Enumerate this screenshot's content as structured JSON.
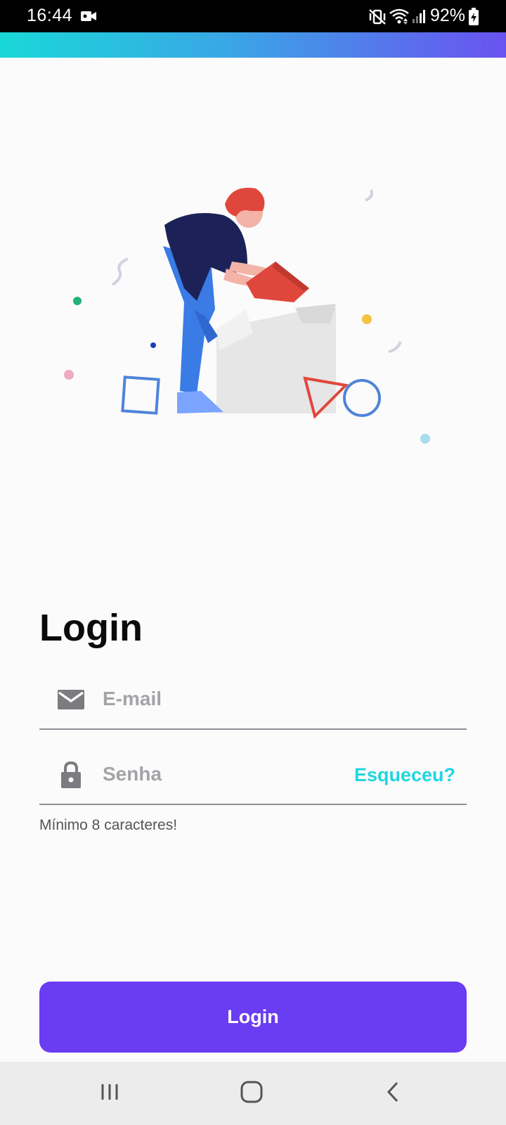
{
  "status_bar": {
    "time": "16:44",
    "battery": "92%",
    "icons": [
      "video-camera-icon",
      "mute-vibrate-icon",
      "wifi-icon",
      "signal-icon",
      "battery-charging-icon"
    ]
  },
  "colors": {
    "accent_gradient_start": "#19d8d8",
    "accent_gradient_end": "#6a52f0",
    "primary_button": "#6a3cf2",
    "link": "#1fd6e0"
  },
  "login": {
    "title": "Login",
    "email_placeholder": "E-mail",
    "email_value": "",
    "password_placeholder": "Senha",
    "password_value": "",
    "forgot_label": "Esqueceu?",
    "helper": "Mínimo 8 caracteres!",
    "button_label": "Login"
  },
  "nav_bar": {
    "items": [
      "recent-apps-icon",
      "home-icon",
      "back-icon"
    ]
  }
}
